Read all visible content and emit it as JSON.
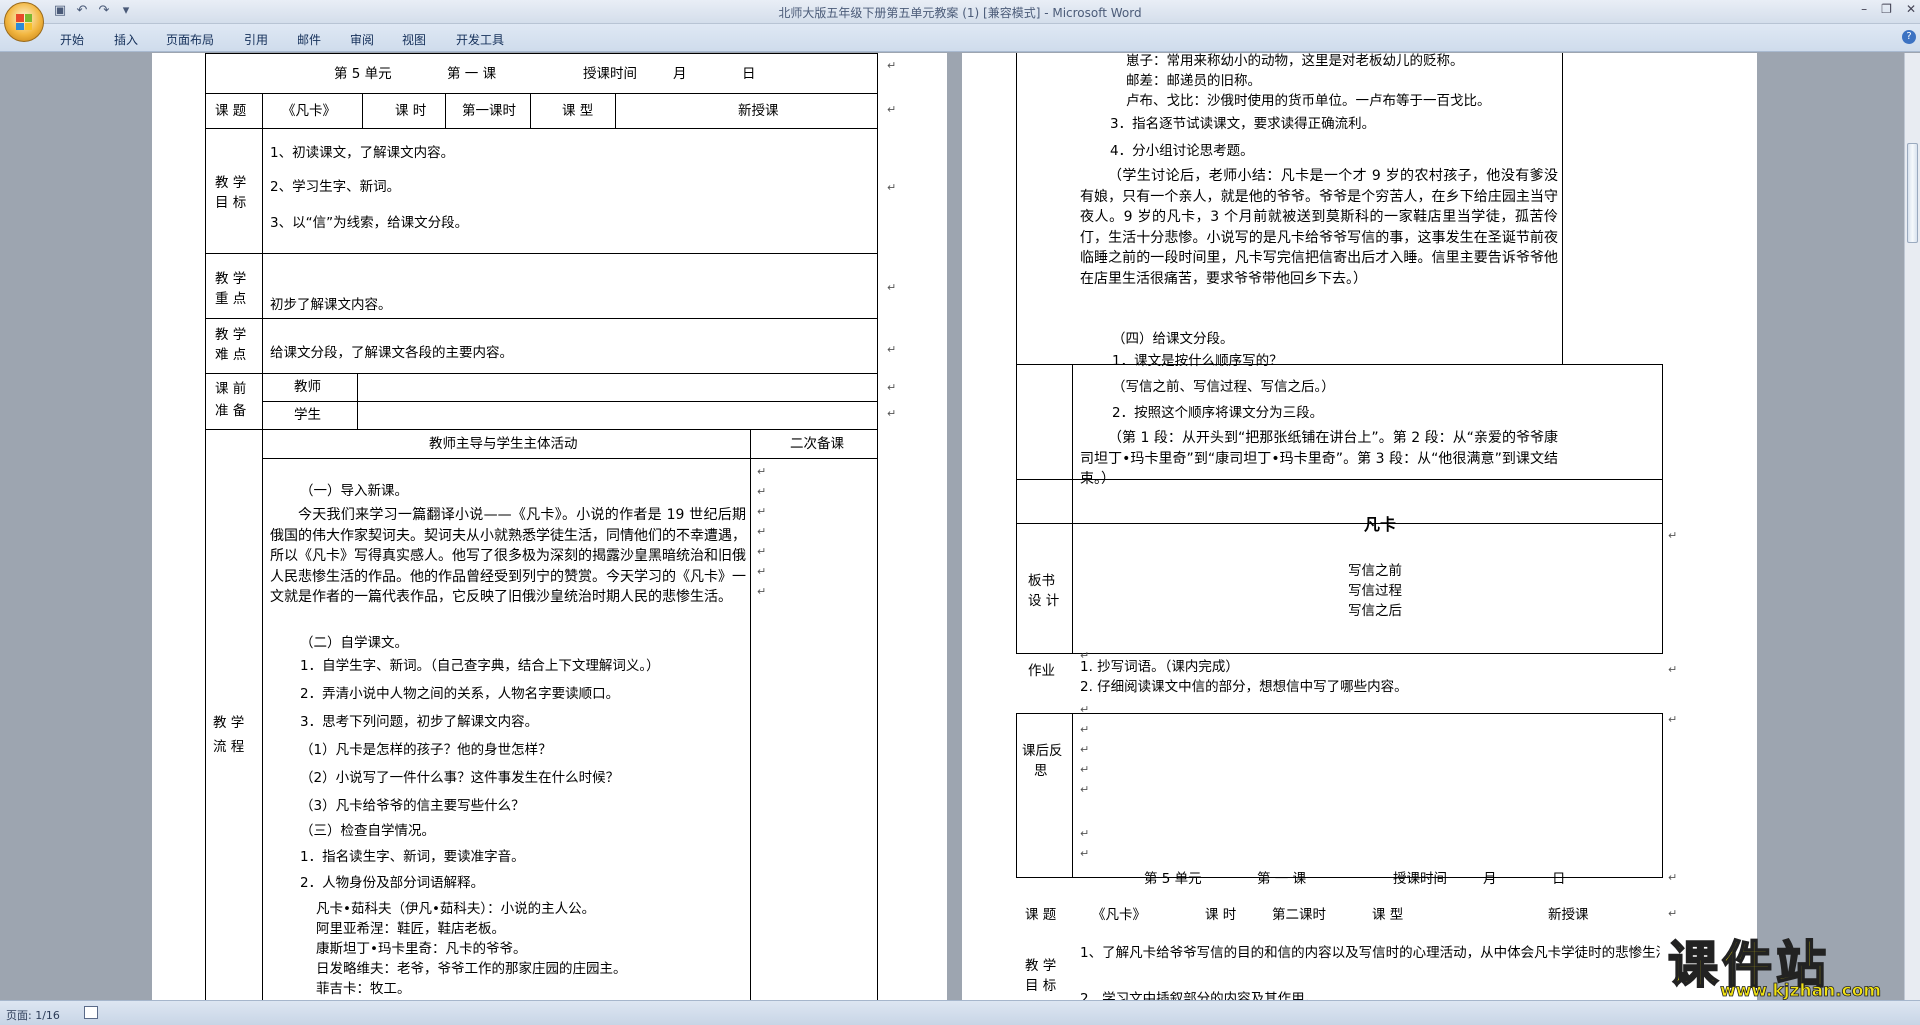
{
  "app": {
    "title": "北师大版五年级下册第五单元教案 (1) [兼容模式] - Microsoft Word",
    "tabs": [
      "开始",
      "插入",
      "页面布局",
      "引用",
      "邮件",
      "审阅",
      "视图",
      "开发工具"
    ],
    "status": {
      "page": "页面: 1/16"
    },
    "window_controls": [
      "–",
      "❐",
      "✕"
    ],
    "help": "?"
  },
  "left": {
    "header": {
      "unit": "第 5 单元",
      "lesson": "第 一 课",
      "time_label": "授课时间",
      "month": "月",
      "day": "日"
    },
    "row1": {
      "topic_label": "课 题",
      "topic": "《凡卡》",
      "hours_label": "课 时",
      "hours": "第一课时",
      "type_label": "课 型",
      "type": "新授课"
    },
    "goals": {
      "label1": "教 学",
      "label2": "目 标",
      "items": [
        "1、初读课文，了解课文内容。",
        "2、学习生字、新词。",
        "3、以“信”为线索，给课文分段。"
      ]
    },
    "key": {
      "label1": "教 学",
      "label2": "重 点",
      "text": "初步了解课文内容。"
    },
    "hard": {
      "label1": "教 学",
      "label2": "难 点",
      "text": "给课文分段，了解课文各段的主要内容。"
    },
    "prep": {
      "label1": "课 前",
      "label2": "准 备",
      "teacher": "教师",
      "student": "学生"
    },
    "flow_header": {
      "main": "教师主导与学生主体活动",
      "second": "二次备课"
    },
    "flow_label": {
      "a": "教 学",
      "b": "流 程"
    },
    "flow": {
      "s1": "（一）导入新课。",
      "p1": "今天我们来学习一篇翻译小说——《凡卡》。小说的作者是 19 世纪后期俄国的伟大作家契诃夫。契诃夫从小就熟悉学徒生活，同情他们的不幸遭遇，所以《凡卡》写得真实感人。他写了很多极为深刻的揭露沙皇黑暗统治和旧俄人民悲惨生活的作品。他的作品曾经受到列宁的赞赏。今天学习的《凡卡》一文就是作者的一篇代表作品，它反映了旧俄沙皇统治时期人民的悲惨生活。",
      "s2": "（二）自学课文。",
      "l1": "1．自学生字、新词。（自己查字典，结合上下文理解词义。）",
      "l2": "2．弄清小说中人物之间的关系，人物名字要读顺口。",
      "l3": "3．思考下列问题，初步了解课文内容。",
      "q1": "（1）凡卡是怎样的孩子？他的身世怎样？",
      "q2": "（2）小说写了一件什么事？这件事发生在什么时候？",
      "q3": "（3）凡卡给爷爷的信主要写些什么？",
      "s3": "（三）检查自学情况。",
      "c1": "1．指名读生字、新词，要读准字音。",
      "c2": "2．人物身份及部分词语解释。",
      "n1": "凡卡•茹科夫（伊凡•茹科夫）：小说的主人公。",
      "n2": "阿里亚希涅：鞋匠，鞋店老板。",
      "n3": "康斯坦丁•玛卡里奇：凡卡的爷爷。",
      "n4": "日发略维夫：老爷，爷爷工作的那家庄园的庄园主。",
      "n5": "菲吉卡：牧工。"
    }
  },
  "right": {
    "top": {
      "w1": "崽子：常用来称幼小的动物，这里是对老板幼儿的贬称。",
      "w2": "邮差：邮递员的旧称。",
      "w3": "卢布、戈比：沙俄时使用的货币单位。一卢布等于一百戈比。",
      "i3": "3．指名逐节试读课文，要求读得正确流利。",
      "i4": "4．分小组讨论思考题。",
      "p2": "（学生讨论后，老师小结：凡卡是一个才 9 岁的农村孩子，他没有爹没有娘，只有一个亲人，就是他的爷爷。爷爷是个穷苦人，在乡下给庄园主当守夜人。9 岁的凡卡，3 个月前就被送到莫斯科的一家鞋店里当学徒，孤苦伶仃，生活十分悲惨。小说写的是凡卡给爷爷写信的事，这事发生在圣诞节前夜临睡之前的一段时间里，凡卡写完信把信寄出后才入睡。信里主要告诉爷爷他在店里生活很痛苦，要求爷爷带他回乡下去。）",
      "s4": "（四）给课文分段。",
      "d1": "1．课文是按什么顺序写的？",
      "d2": "（写信之前、写信过程、写信之后。）",
      "d3": "2．按照这个顺序将课文分为三段。",
      "p3": "（第 1 段：从开头到“把那张纸铺在讲台上”。第 2 段：从“亲爱的爷爷康司坦丁•玛卡里奇”到“康司坦丁•玛卡里奇”。第 3 段：从“他很满意”到课文结束。）"
    },
    "board": {
      "label1": "板书",
      "label2": "设 计",
      "title": "凡卡",
      "l1": "写信之前",
      "l2": "写信过程",
      "l3": "写信之后"
    },
    "homework": {
      "label": "作业",
      "l1": "1. 抄写词语。（课内完成）",
      "l2": "2. 仔细阅读课文中信的部分，想想信中写了哪些内容。"
    },
    "reflect": {
      "label1": "课后反",
      "label2": "思"
    },
    "header2": {
      "unit": "第 5 单元",
      "lesson": "第 一 课",
      "time_label": "授课时间",
      "month": "月",
      "day": "日"
    },
    "row2": {
      "topic_label": "课 题",
      "topic": "《凡卡》",
      "hours_label": "课 时",
      "hours": "第二课时",
      "type_label": "课 型",
      "type": "新授课"
    },
    "goals2": {
      "label1": "教 学",
      "label2": "目 标",
      "l1": "1、了解凡卡给爷爷写信的目的和信的内容以及写信时的心理活动，从中体会凡卡学徒时的悲惨生活",
      "l2": "2、学习文中插叙部分的内容及其作用。"
    }
  },
  "watermark": {
    "cn": "课件站",
    "url": "www.kjzhan.com"
  },
  "colors": {
    "ribbon": "#cfdcec",
    "page": "#ffffff",
    "workspace": "#9da5b0",
    "watermark": "#f2e312"
  }
}
